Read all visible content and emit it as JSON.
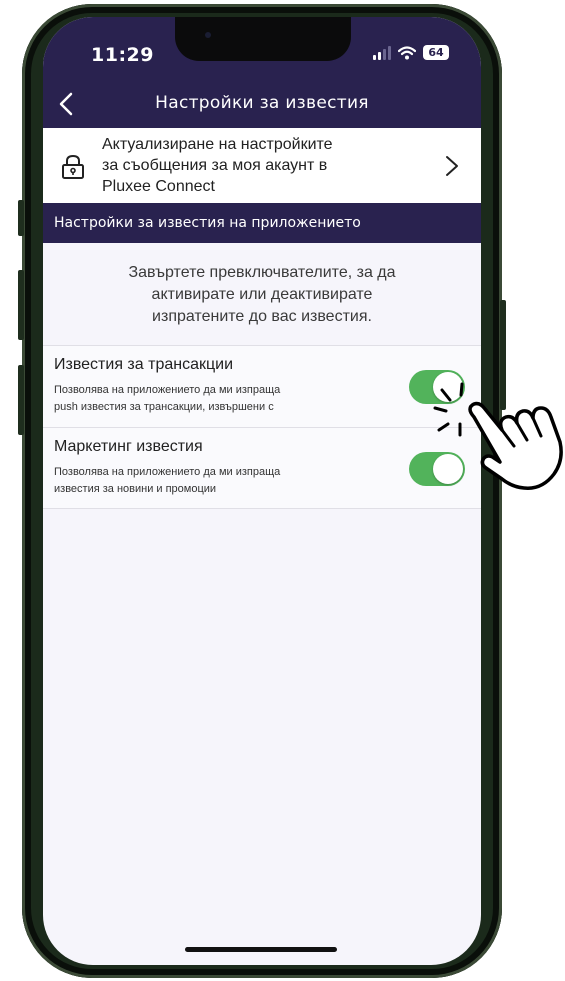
{
  "status_bar": {
    "time": "11:29",
    "battery": "64"
  },
  "header": {
    "title": "Настройки за известия"
  },
  "account_link": {
    "lines": [
      "Актуализиране на настройките",
      "за съобщения за моя акаунт в",
      "Pluxee Connect"
    ],
    "icon": "lock-icon",
    "chevron": "chevron-right-icon"
  },
  "section": {
    "title": "Настройки за известия на приложението"
  },
  "info": {
    "lines": [
      "Завъртете превключвателите, за да",
      "активирате или деактивирате",
      "изпратените до вас известия."
    ]
  },
  "preferences": [
    {
      "title": "Известия за трансакции",
      "desc_lines": [
        "Позволява на приложението да ми изпраща",
        "push известия за трансакции, извършени с"
      ],
      "enabled": true
    },
    {
      "title": "Маркетинг известия",
      "desc_lines": [
        "Позволява на приложението да ми изпраща",
        "известия за новини и промоции"
      ],
      "enabled": true
    }
  ],
  "colors": {
    "header": "#29224f",
    "toggle_on": "#52b35b",
    "background": "#f6f5fb"
  }
}
